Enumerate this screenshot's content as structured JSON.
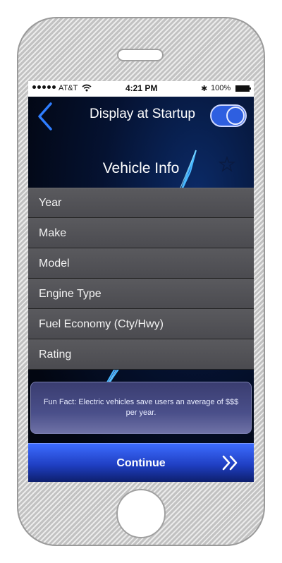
{
  "status_bar": {
    "carrier": "AT&T",
    "time": "4:21 PM",
    "battery": "100%"
  },
  "header": {
    "startup_label": "Display at Startup",
    "startup_toggle_on": true
  },
  "page": {
    "title": "Vehicle Info"
  },
  "info_rows": [
    {
      "label": "Year"
    },
    {
      "label": "Make"
    },
    {
      "label": "Model"
    },
    {
      "label": "Engine Type"
    },
    {
      "label": "Fuel Economy (Cty/Hwy)"
    },
    {
      "label": "Rating"
    }
  ],
  "fun_fact": "Fun Fact: Electric vehicles save users an average of $$$ per year.",
  "footer": {
    "continue_label": "Continue"
  },
  "icons": {
    "back": "back-chevron-icon",
    "favorite": "star-outline-icon",
    "next": "double-chevron-right-icon",
    "bluetooth": "bluetooth-icon",
    "wifi": "wifi-icon",
    "battery": "battery-icon"
  },
  "colors": {
    "accent": "#2e5fe0",
    "background": "#020611",
    "row": "#505055"
  }
}
